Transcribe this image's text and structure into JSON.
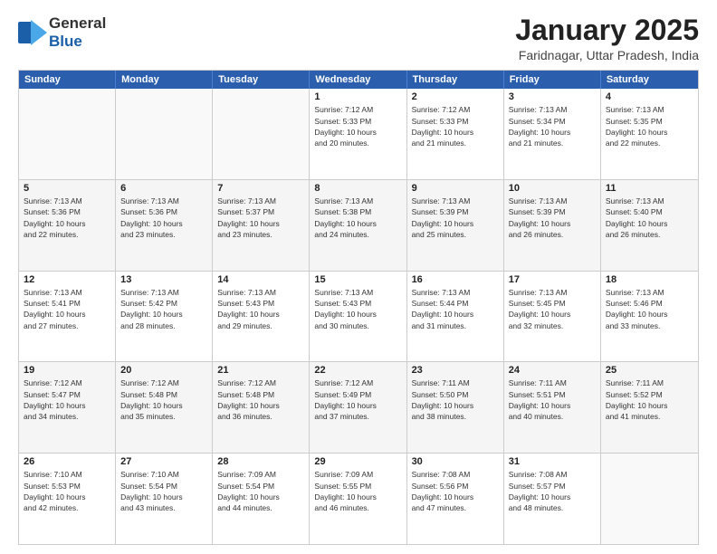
{
  "header": {
    "logo_general": "General",
    "logo_blue": "Blue",
    "month_title": "January 2025",
    "location": "Faridnagar, Uttar Pradesh, India"
  },
  "weekdays": [
    "Sunday",
    "Monday",
    "Tuesday",
    "Wednesday",
    "Thursday",
    "Friday",
    "Saturday"
  ],
  "rows": [
    [
      {
        "day": "",
        "info": ""
      },
      {
        "day": "",
        "info": ""
      },
      {
        "day": "",
        "info": ""
      },
      {
        "day": "1",
        "info": "Sunrise: 7:12 AM\nSunset: 5:33 PM\nDaylight: 10 hours\nand 20 minutes."
      },
      {
        "day": "2",
        "info": "Sunrise: 7:12 AM\nSunset: 5:33 PM\nDaylight: 10 hours\nand 21 minutes."
      },
      {
        "day": "3",
        "info": "Sunrise: 7:13 AM\nSunset: 5:34 PM\nDaylight: 10 hours\nand 21 minutes."
      },
      {
        "day": "4",
        "info": "Sunrise: 7:13 AM\nSunset: 5:35 PM\nDaylight: 10 hours\nand 22 minutes."
      }
    ],
    [
      {
        "day": "5",
        "info": "Sunrise: 7:13 AM\nSunset: 5:36 PM\nDaylight: 10 hours\nand 22 minutes."
      },
      {
        "day": "6",
        "info": "Sunrise: 7:13 AM\nSunset: 5:36 PM\nDaylight: 10 hours\nand 23 minutes."
      },
      {
        "day": "7",
        "info": "Sunrise: 7:13 AM\nSunset: 5:37 PM\nDaylight: 10 hours\nand 23 minutes."
      },
      {
        "day": "8",
        "info": "Sunrise: 7:13 AM\nSunset: 5:38 PM\nDaylight: 10 hours\nand 24 minutes."
      },
      {
        "day": "9",
        "info": "Sunrise: 7:13 AM\nSunset: 5:39 PM\nDaylight: 10 hours\nand 25 minutes."
      },
      {
        "day": "10",
        "info": "Sunrise: 7:13 AM\nSunset: 5:39 PM\nDaylight: 10 hours\nand 26 minutes."
      },
      {
        "day": "11",
        "info": "Sunrise: 7:13 AM\nSunset: 5:40 PM\nDaylight: 10 hours\nand 26 minutes."
      }
    ],
    [
      {
        "day": "12",
        "info": "Sunrise: 7:13 AM\nSunset: 5:41 PM\nDaylight: 10 hours\nand 27 minutes."
      },
      {
        "day": "13",
        "info": "Sunrise: 7:13 AM\nSunset: 5:42 PM\nDaylight: 10 hours\nand 28 minutes."
      },
      {
        "day": "14",
        "info": "Sunrise: 7:13 AM\nSunset: 5:43 PM\nDaylight: 10 hours\nand 29 minutes."
      },
      {
        "day": "15",
        "info": "Sunrise: 7:13 AM\nSunset: 5:43 PM\nDaylight: 10 hours\nand 30 minutes."
      },
      {
        "day": "16",
        "info": "Sunrise: 7:13 AM\nSunset: 5:44 PM\nDaylight: 10 hours\nand 31 minutes."
      },
      {
        "day": "17",
        "info": "Sunrise: 7:13 AM\nSunset: 5:45 PM\nDaylight: 10 hours\nand 32 minutes."
      },
      {
        "day": "18",
        "info": "Sunrise: 7:13 AM\nSunset: 5:46 PM\nDaylight: 10 hours\nand 33 minutes."
      }
    ],
    [
      {
        "day": "19",
        "info": "Sunrise: 7:12 AM\nSunset: 5:47 PM\nDaylight: 10 hours\nand 34 minutes."
      },
      {
        "day": "20",
        "info": "Sunrise: 7:12 AM\nSunset: 5:48 PM\nDaylight: 10 hours\nand 35 minutes."
      },
      {
        "day": "21",
        "info": "Sunrise: 7:12 AM\nSunset: 5:48 PM\nDaylight: 10 hours\nand 36 minutes."
      },
      {
        "day": "22",
        "info": "Sunrise: 7:12 AM\nSunset: 5:49 PM\nDaylight: 10 hours\nand 37 minutes."
      },
      {
        "day": "23",
        "info": "Sunrise: 7:11 AM\nSunset: 5:50 PM\nDaylight: 10 hours\nand 38 minutes."
      },
      {
        "day": "24",
        "info": "Sunrise: 7:11 AM\nSunset: 5:51 PM\nDaylight: 10 hours\nand 40 minutes."
      },
      {
        "day": "25",
        "info": "Sunrise: 7:11 AM\nSunset: 5:52 PM\nDaylight: 10 hours\nand 41 minutes."
      }
    ],
    [
      {
        "day": "26",
        "info": "Sunrise: 7:10 AM\nSunset: 5:53 PM\nDaylight: 10 hours\nand 42 minutes."
      },
      {
        "day": "27",
        "info": "Sunrise: 7:10 AM\nSunset: 5:54 PM\nDaylight: 10 hours\nand 43 minutes."
      },
      {
        "day": "28",
        "info": "Sunrise: 7:09 AM\nSunset: 5:54 PM\nDaylight: 10 hours\nand 44 minutes."
      },
      {
        "day": "29",
        "info": "Sunrise: 7:09 AM\nSunset: 5:55 PM\nDaylight: 10 hours\nand 46 minutes."
      },
      {
        "day": "30",
        "info": "Sunrise: 7:08 AM\nSunset: 5:56 PM\nDaylight: 10 hours\nand 47 minutes."
      },
      {
        "day": "31",
        "info": "Sunrise: 7:08 AM\nSunset: 5:57 PM\nDaylight: 10 hours\nand 48 minutes."
      },
      {
        "day": "",
        "info": ""
      }
    ]
  ]
}
